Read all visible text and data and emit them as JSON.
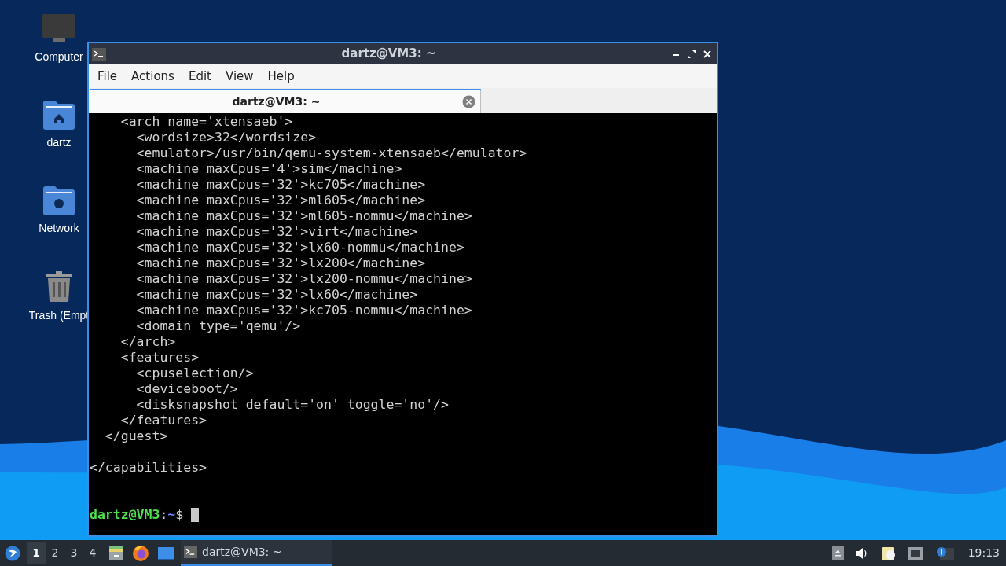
{
  "desktop_icons": [
    {
      "kind": "computer",
      "label": "Computer"
    },
    {
      "kind": "home",
      "label": "dartz"
    },
    {
      "kind": "network",
      "label": "Network"
    },
    {
      "kind": "trash",
      "label": "Trash (Empt"
    }
  ],
  "window": {
    "title": "dartz@VM3: ~",
    "menu": [
      "File",
      "Actions",
      "Edit",
      "View",
      "Help"
    ],
    "tabs": [
      {
        "label": "dartz@VM3: ~",
        "selected": true
      }
    ],
    "terminal": {
      "lines": [
        {
          "kind": "text",
          "text": "    <arch name='xtensaeb'>"
        },
        {
          "kind": "text",
          "text": "      <wordsize>32</wordsize>"
        },
        {
          "kind": "text",
          "text": "      <emulator>/usr/bin/qemu-system-xtensaeb</emulator>"
        },
        {
          "kind": "text",
          "text": "      <machine maxCpus='4'>sim</machine>"
        },
        {
          "kind": "text",
          "text": "      <machine maxCpus='32'>kc705</machine>"
        },
        {
          "kind": "text",
          "text": "      <machine maxCpus='32'>ml605</machine>"
        },
        {
          "kind": "text",
          "text": "      <machine maxCpus='32'>ml605-nommu</machine>"
        },
        {
          "kind": "text",
          "text": "      <machine maxCpus='32'>virt</machine>"
        },
        {
          "kind": "text",
          "text": "      <machine maxCpus='32'>lx60-nommu</machine>"
        },
        {
          "kind": "text",
          "text": "      <machine maxCpus='32'>lx200</machine>"
        },
        {
          "kind": "text",
          "text": "      <machine maxCpus='32'>lx200-nommu</machine>"
        },
        {
          "kind": "text",
          "text": "      <machine maxCpus='32'>lx60</machine>"
        },
        {
          "kind": "text",
          "text": "      <machine maxCpus='32'>kc705-nommu</machine>"
        },
        {
          "kind": "text",
          "text": "      <domain type='qemu'/>"
        },
        {
          "kind": "text",
          "text": "    </arch>"
        },
        {
          "kind": "text",
          "text": "    <features>"
        },
        {
          "kind": "text",
          "text": "      <cpuselection/>"
        },
        {
          "kind": "text",
          "text": "      <deviceboot/>"
        },
        {
          "kind": "text",
          "text": "      <disksnapshot default='on' toggle='no'/>"
        },
        {
          "kind": "text",
          "text": "    </features>"
        },
        {
          "kind": "text",
          "text": "  </guest>"
        },
        {
          "kind": "blank"
        },
        {
          "kind": "text",
          "text": "</capabilities>"
        },
        {
          "kind": "blank"
        },
        {
          "kind": "blank"
        },
        {
          "kind": "prompt",
          "user_host": "dartz@VM3",
          "separator": ":",
          "path": "~",
          "symbol": "$"
        }
      ]
    }
  },
  "taskbar": {
    "workspaces": [
      {
        "label": "1",
        "selected": true
      },
      {
        "label": "2",
        "selected": false
      },
      {
        "label": "3",
        "selected": false
      },
      {
        "label": "4",
        "selected": false
      }
    ],
    "tasks": [
      {
        "label": "dartz@VM3: ~",
        "selected": true
      }
    ],
    "clock": "19:13"
  }
}
